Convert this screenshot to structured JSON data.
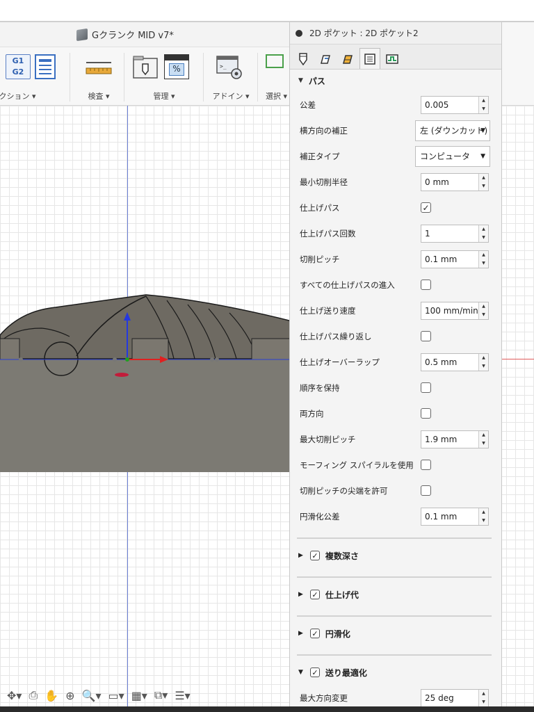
{
  "document": {
    "title": "Gクランク MID v7*"
  },
  "toolbar": {
    "groups": [
      {
        "label": "アクション ▾"
      },
      {
        "label": "検査 ▾"
      },
      {
        "label": "管理 ▾"
      },
      {
        "label": "アドイン ▾"
      },
      {
        "label": "選択 ▾"
      }
    ],
    "g_icon": {
      "line1": "G1",
      "line2": "G2"
    },
    "percent_glyph": "%"
  },
  "panel": {
    "title": "2D ポケット : 2D ポケット2",
    "tabs": [
      "tool-tab",
      "geometry-tab",
      "heights-tab",
      "passes-tab",
      "linking-tab"
    ],
    "section": {
      "label": "パス"
    },
    "rows": [
      {
        "name": "公差",
        "type": "spin",
        "value": "0.005"
      },
      {
        "name": "横方向の補正",
        "type": "drop",
        "value": "左 (ダウンカット)"
      },
      {
        "name": "補正タイプ",
        "type": "drop",
        "value": "コンピュータ"
      },
      {
        "name": "最小切削半径",
        "type": "spin",
        "value": "0 mm"
      },
      {
        "name": "仕上げパス",
        "type": "check",
        "checked": true
      },
      {
        "name": "仕上げパス回数",
        "type": "spin",
        "value": "1"
      },
      {
        "name": "切削ピッチ",
        "type": "spin",
        "value": "0.1 mm"
      },
      {
        "name": "すべての仕上げパスの進入",
        "type": "check",
        "checked": false
      },
      {
        "name": "仕上げ送り速度",
        "type": "spin",
        "value": "100 mm/min"
      },
      {
        "name": "仕上げパス繰り返し",
        "type": "check",
        "checked": false
      },
      {
        "name": "仕上げオーバーラップ",
        "type": "spin",
        "value": "0.5 mm"
      },
      {
        "name": "順序を保持",
        "type": "check",
        "checked": false
      },
      {
        "name": "両方向",
        "type": "check",
        "checked": false
      },
      {
        "name": "最大切削ピッチ",
        "type": "spin",
        "value": "1.9 mm"
      },
      {
        "name": "モーフィング スパイラルを使用",
        "type": "check",
        "checked": false
      },
      {
        "name": "切削ピッチの尖端を許可",
        "type": "check",
        "checked": false
      },
      {
        "name": "円滑化公差",
        "type": "spin",
        "value": "0.1 mm"
      }
    ],
    "groups": [
      {
        "label": "複数深さ",
        "expanded": false,
        "checked": true
      },
      {
        "label": "仕上げ代",
        "expanded": false,
        "checked": true
      },
      {
        "label": "円滑化",
        "expanded": false,
        "checked": true
      },
      {
        "label": "送り最適化",
        "expanded": true,
        "checked": true
      }
    ],
    "feed_rows": [
      {
        "name": "最大方向変更",
        "type": "spin",
        "value": "25 deg"
      }
    ]
  },
  "glyphs": {
    "checked": "✓",
    "tri_down": "▼",
    "tri_right": "▶",
    "caret": "▼",
    "up": "▲",
    "down": "▼"
  },
  "colors": {
    "stock": "#7c7a73",
    "axis_blue": "#6b7fd4",
    "panel_bg": "#f4f4f4"
  }
}
